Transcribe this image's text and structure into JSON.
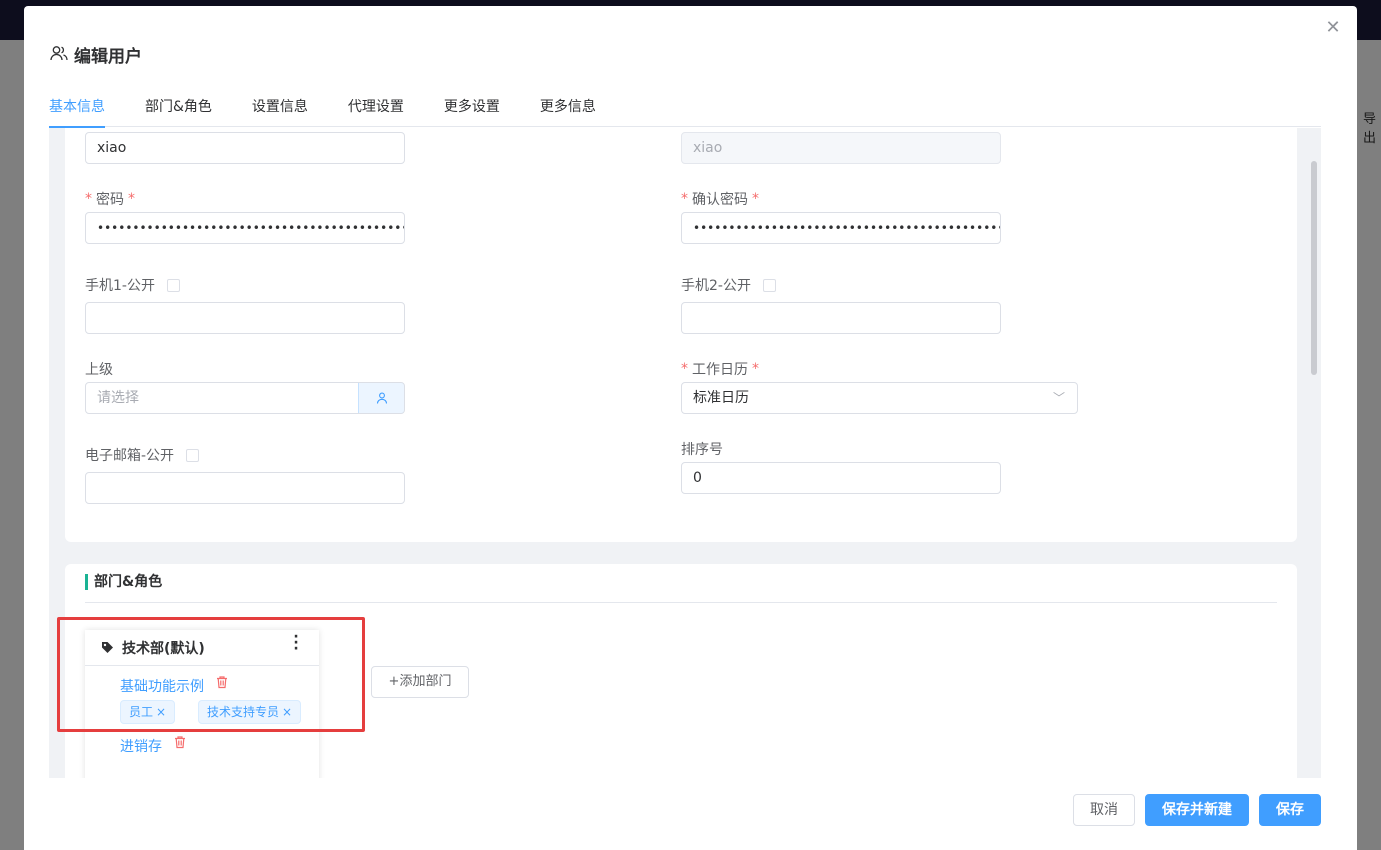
{
  "dialog": {
    "title": "编辑用户",
    "tabs": [
      "基本信息",
      "部门&角色",
      "设置信息",
      "代理设置",
      "更多设置",
      "更多信息"
    ]
  },
  "form": {
    "login_value": "xiao",
    "name_value": "xiao",
    "password_label": "密码",
    "password_value": "••••••••••••••••••••••••••••••••••••••••••••••",
    "confirm_password_label": "确认密码",
    "confirm_password_value": "••••••••••••••••••••••••••••••••••••••••••••••",
    "mobile1_label": "手机1-公开",
    "mobile2_label": "手机2-公开",
    "superior_label": "上级",
    "superior_placeholder": "请选择",
    "calendar_label": "工作日历",
    "calendar_value": "标准日历",
    "email_label": "电子邮箱-公开",
    "sort_label": "排序号",
    "sort_value": "0",
    "required_mark": "*"
  },
  "dept_section": {
    "title": "部门&角色",
    "dept_name": "技术部(默认)",
    "roles": [
      {
        "name": "基础功能示例",
        "tags": [
          "员工",
          "技术支持专员"
        ]
      },
      {
        "name": "进销存",
        "tags": []
      }
    ],
    "add_dept_label": "+添加部门",
    "tag_close": "×"
  },
  "footer": {
    "cancel_label": "取消",
    "save_new_label": "保存并新建",
    "save_label": "保存"
  },
  "background": {
    "right_text": "导出"
  },
  "colors": {
    "primary": "#409eff",
    "danger": "#f56c6c",
    "section_accent": "#1ab394",
    "highlight_box": "#e53e3e"
  }
}
